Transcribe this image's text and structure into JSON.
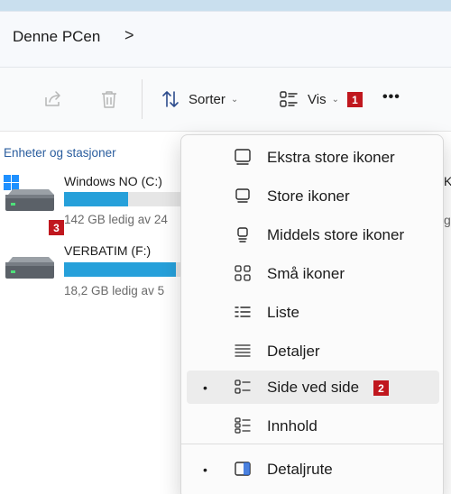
{
  "address": {
    "breadcrumb": "Denne PCen",
    "chevron": ">"
  },
  "toolbar": {
    "sort_label": "Sorter",
    "view_label": "Vis",
    "more_label": "•••",
    "view_badge": "1",
    "icons": [
      "share-icon",
      "delete-icon",
      "sort-icon",
      "view-icon",
      "more-icon"
    ]
  },
  "section": {
    "title": "Enheter og stasjoner"
  },
  "drives": [
    {
      "name": "Windows NO (C:)",
      "free": "142 GB ledig av 24",
      "used_fraction": 0.55,
      "badge": "3"
    },
    {
      "name": "VERBATIM (F:)",
      "free": "18,2 GB ledig av 5",
      "used_fraction": 0.96
    }
  ],
  "right_peek": {
    "letter_top": "K",
    "letter_bottom": "g"
  },
  "view_menu": {
    "items": [
      {
        "label": "Ekstra store ikoner",
        "icon": "extra-large-icons-icon",
        "checked": false
      },
      {
        "label": "Store ikoner",
        "icon": "large-icons-icon",
        "checked": false
      },
      {
        "label": "Middels store ikoner",
        "icon": "medium-icons-icon",
        "checked": false
      },
      {
        "label": "Små ikoner",
        "icon": "small-icons-icon",
        "checked": false
      },
      {
        "label": "Liste",
        "icon": "list-icon",
        "checked": false
      },
      {
        "label": "Detaljer",
        "icon": "details-icon",
        "checked": false
      },
      {
        "label": "Side ved side",
        "icon": "tiles-icon",
        "checked": true,
        "badge": "2"
      },
      {
        "label": "Innhold",
        "icon": "content-icon",
        "checked": false
      },
      {
        "label": "Detaljrute",
        "icon": "details-pane-icon",
        "checked": true
      }
    ],
    "bullet": "•"
  },
  "colors": {
    "accent": "#26a0da",
    "badge": "#c0171e",
    "link": "#2a5d9e"
  }
}
